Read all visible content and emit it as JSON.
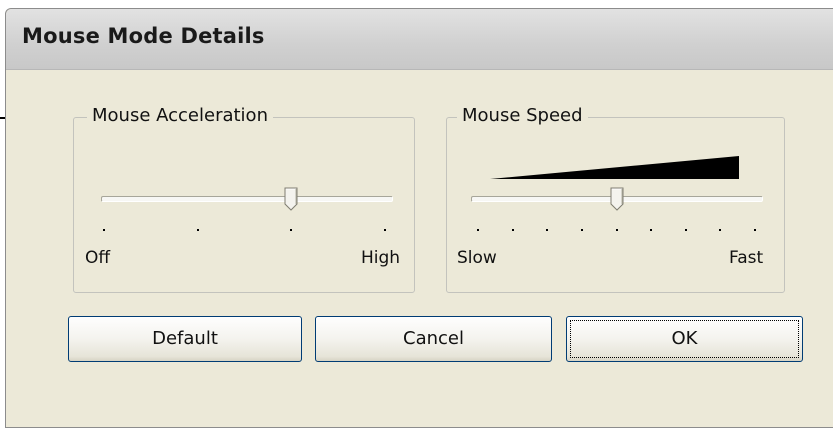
{
  "dialog": {
    "title": "Mouse Mode Details"
  },
  "acceleration": {
    "label": "Mouse Acceleration",
    "tick_count": 4,
    "value_fraction": 0.667,
    "min_label": "Off",
    "max_label": "High"
  },
  "speed": {
    "label": "Mouse Speed",
    "tick_count": 9,
    "value_fraction": 0.5,
    "min_label": "Slow",
    "max_label": "Fast"
  },
  "buttons": {
    "default_label": "Default",
    "cancel_label": "Cancel",
    "ok_label": "OK"
  }
}
